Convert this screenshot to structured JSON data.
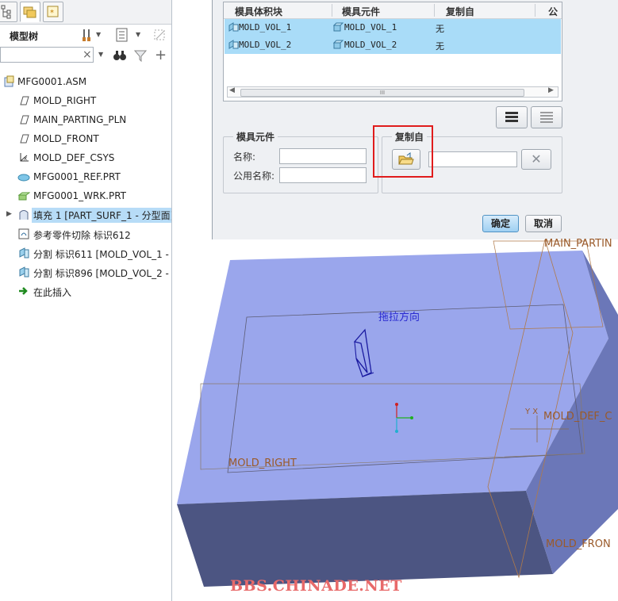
{
  "model_tree": {
    "title": "模型树",
    "search": {
      "value": "",
      "placeholder": ""
    },
    "items": [
      {
        "label": "MFG0001.ASM",
        "icon": "assembly-icon"
      },
      {
        "label": "MOLD_RIGHT",
        "icon": "datum-plane-icon"
      },
      {
        "label": "MAIN_PARTING_PLN",
        "icon": "datum-plane-icon"
      },
      {
        "label": "MOLD_FRONT",
        "icon": "datum-plane-icon"
      },
      {
        "label": "MOLD_DEF_CSYS",
        "icon": "csys-icon"
      },
      {
        "label": "MFG0001_REF.PRT",
        "icon": "ref-part-icon"
      },
      {
        "label": "MFG0001_WRK.PRT",
        "icon": "workpiece-icon"
      },
      {
        "label": "填充 1 [PART_SURF_1 - 分型面]",
        "icon": "surface-fill-icon",
        "selected": true
      },
      {
        "label": "参考零件切除 标识612",
        "icon": "cutout-icon"
      },
      {
        "label": "分割 标识611 [MOLD_VOL_1 -",
        "icon": "split-icon"
      },
      {
        "label": "分割 标识896 [MOLD_VOL_2 -",
        "icon": "split-icon"
      },
      {
        "label": "在此插入",
        "icon": "insert-here-arrow-icon"
      }
    ]
  },
  "dialog": {
    "columns": [
      "模具体积块",
      "模具元件",
      "复制自",
      "公"
    ],
    "rows": [
      {
        "volume": "MOLD_VOL_1",
        "component": "MOLD_VOL_1",
        "copy_from": "无"
      },
      {
        "volume": "MOLD_VOL_2",
        "component": "MOLD_VOL_2",
        "copy_from": "无"
      }
    ],
    "mold_component_group": {
      "title": "模具元件",
      "name_label": "名称:",
      "name_value": "",
      "common_name_label": "公用名称:",
      "common_name_value": ""
    },
    "copy_from_group": {
      "title": "复制自",
      "path_value": ""
    },
    "ok_label": "确定",
    "cancel_label": "取消",
    "scroll_glyph": "III"
  },
  "viewport": {
    "labels": {
      "pull_direction": "拖拉方向",
      "main_parting": "MAIN_PARTIN",
      "mold_def": "MOLD_DEF_C",
      "mold_right": "MOLD_RIGHT",
      "mold_front": "MOLD_FRON",
      "csys_axes": "Y X"
    },
    "colors": {
      "block_top": "#9aa6ec",
      "block_front": "#4c5582",
      "block_side": "#6b77b8",
      "datum": "#a06a3a"
    }
  },
  "watermark": "BBS.CHINADE.NET"
}
